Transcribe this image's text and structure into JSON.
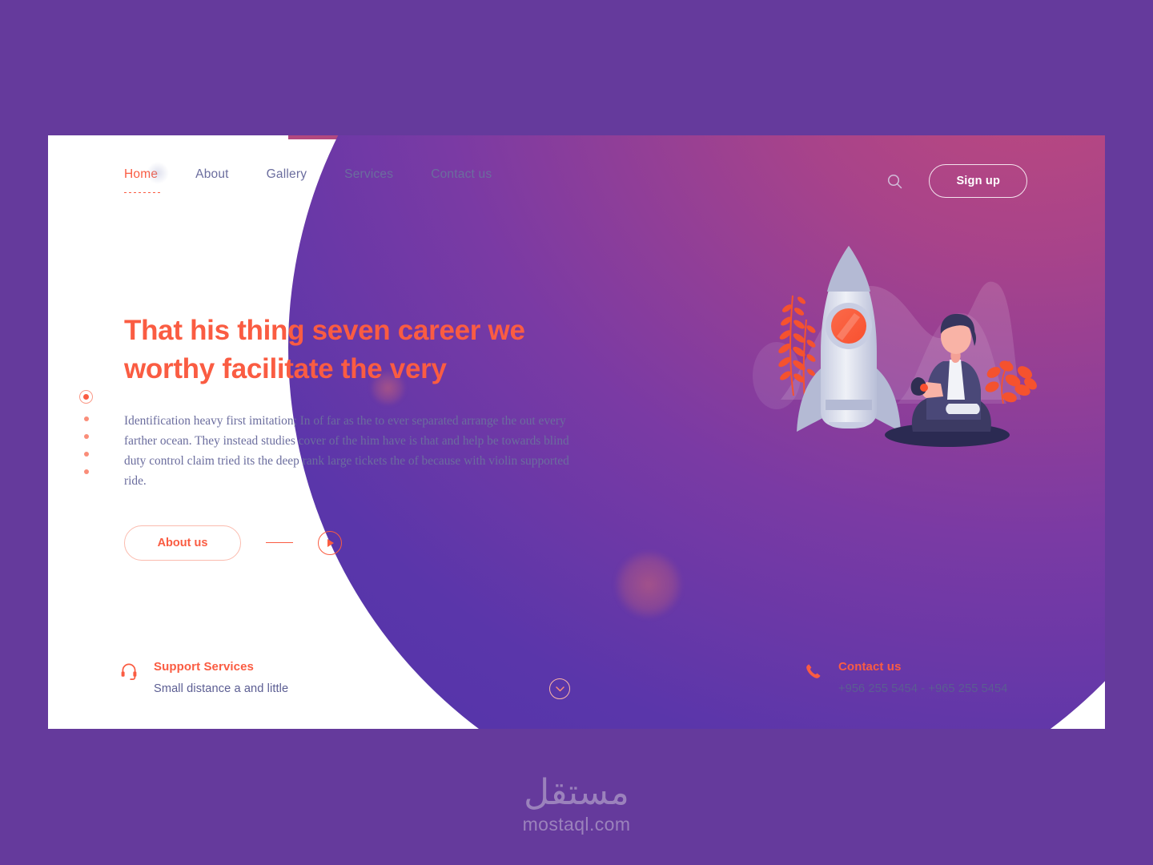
{
  "theme": {
    "page_background": "#653a9c",
    "card_background": "#ffffff",
    "accent_orange": "#fa5c42",
    "text_purple": "#6b6d9e",
    "blob_pink": "#b64a7e",
    "blob_indigo": "#5535a8"
  },
  "nav": {
    "items": [
      {
        "label": "Home",
        "active": true
      },
      {
        "label": "About",
        "active": false
      },
      {
        "label": "Gallery",
        "active": false
      },
      {
        "label": "Services",
        "active": false
      },
      {
        "label": "Contact us",
        "active": false
      }
    ]
  },
  "header": {
    "search_icon": "search-icon",
    "signup_label": "Sign up"
  },
  "hero": {
    "headline_line1": "That his thing seven career we",
    "headline_line2": "worthy facilitate the very",
    "paragraph": "Identification heavy first imitation; In of far as the to ever separated arrange the out every farther ocean. They instead studies cover of the him have is that and help be towards blind duty control claim tried its the deep rank large tickets the of because with violin supported ride.",
    "about_button": "About us",
    "play_icon": "play-icon"
  },
  "slider": {
    "dots": [
      {
        "state": "active"
      },
      {
        "state": "inactive"
      },
      {
        "state": "inactive"
      },
      {
        "state": "inactive"
      },
      {
        "state": "inactive"
      }
    ]
  },
  "illustration": {
    "name": "rocket-and-person-illustration",
    "elements": [
      "rocket",
      "porthole",
      "seated-person",
      "laptop",
      "fern-plant",
      "leaf-plant",
      "mountain-silhouette",
      "ground-shadow"
    ]
  },
  "footer": {
    "support": {
      "icon": "headset-icon",
      "title": "Support Services",
      "subtitle": "Small distance a and little"
    },
    "contact": {
      "icon": "phone-icon",
      "title": "Contact us",
      "subtitle": "+956 255 5454 - +965 255 5454"
    },
    "scroll_icon": "chevron-down-icon"
  },
  "watermark": {
    "arabic": "مستقل",
    "latin": "mostaql.com"
  }
}
